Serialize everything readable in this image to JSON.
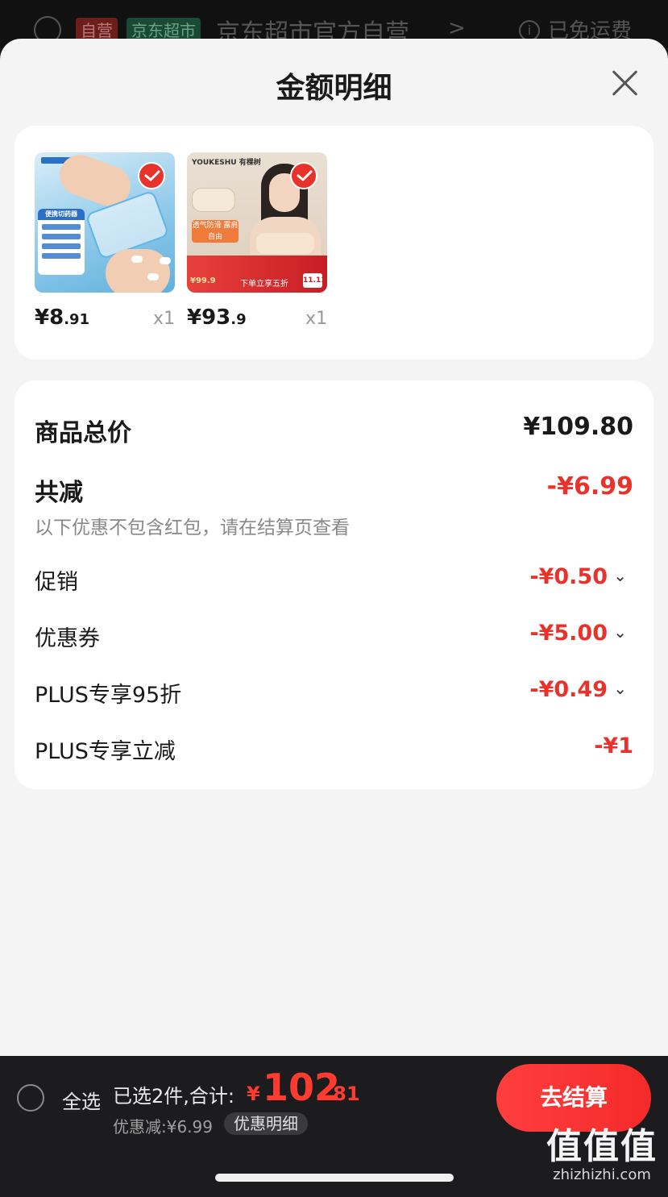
{
  "background_header": {
    "tag_self": "自营",
    "tag_market": "京东超市",
    "store_name": "京东超市官方自营",
    "store_arrow": ">",
    "info_glyph": "i",
    "shipping": "已免运费"
  },
  "sheet": {
    "title": "金额明细",
    "close_icon": "close-icon"
  },
  "products": [
    {
      "price_int": "¥8",
      "price_dec": ".91",
      "qty": "x1",
      "selected": true,
      "artwork": {
        "panel_title": "便携切药器"
      }
    },
    {
      "price_int": "¥93",
      "price_dec": ".9",
      "qty": "x1",
      "selected": true,
      "artwork": {
        "brand": "YOUKESHU 有棵树",
        "caption": "透气防滑 露肩自由",
        "strip_price": "¥99.9",
        "strip_sale": "下单立享五折",
        "strip_badge": "11.11"
      }
    }
  ],
  "summary": {
    "total_label": "商品总价",
    "total_value": "¥109.80",
    "reduce_label": "共减",
    "reduce_value": "-¥6.99",
    "note": "以下优惠不包含红包，请在结算页查看",
    "items": [
      {
        "label": "促销",
        "value": "-¥0.50",
        "chevron": "⌄"
      },
      {
        "label": "优惠券",
        "value": "-¥5.00",
        "chevron": "⌄"
      },
      {
        "label": "PLUS专享95折",
        "value": "-¥0.49",
        "chevron": "⌄"
      },
      {
        "label": "PLUS专享立减",
        "value": "-¥1"
      }
    ]
  },
  "bottom_bar": {
    "select_all": "全选",
    "selected_count": "已选2件,合计:",
    "total_currency": "¥",
    "total_int": "102",
    "total_dec": ".81",
    "discount": "优惠减:¥6.99",
    "detail_button": "优惠明细",
    "checkout_button": "去结算"
  },
  "watermark": {
    "big": "值值值",
    "small": "zhizhizhi.com"
  },
  "colors": {
    "accent_red": "#e8332c",
    "checkout_red": "#ff3e3e",
    "sheet_bg": "#f4f4f4"
  }
}
